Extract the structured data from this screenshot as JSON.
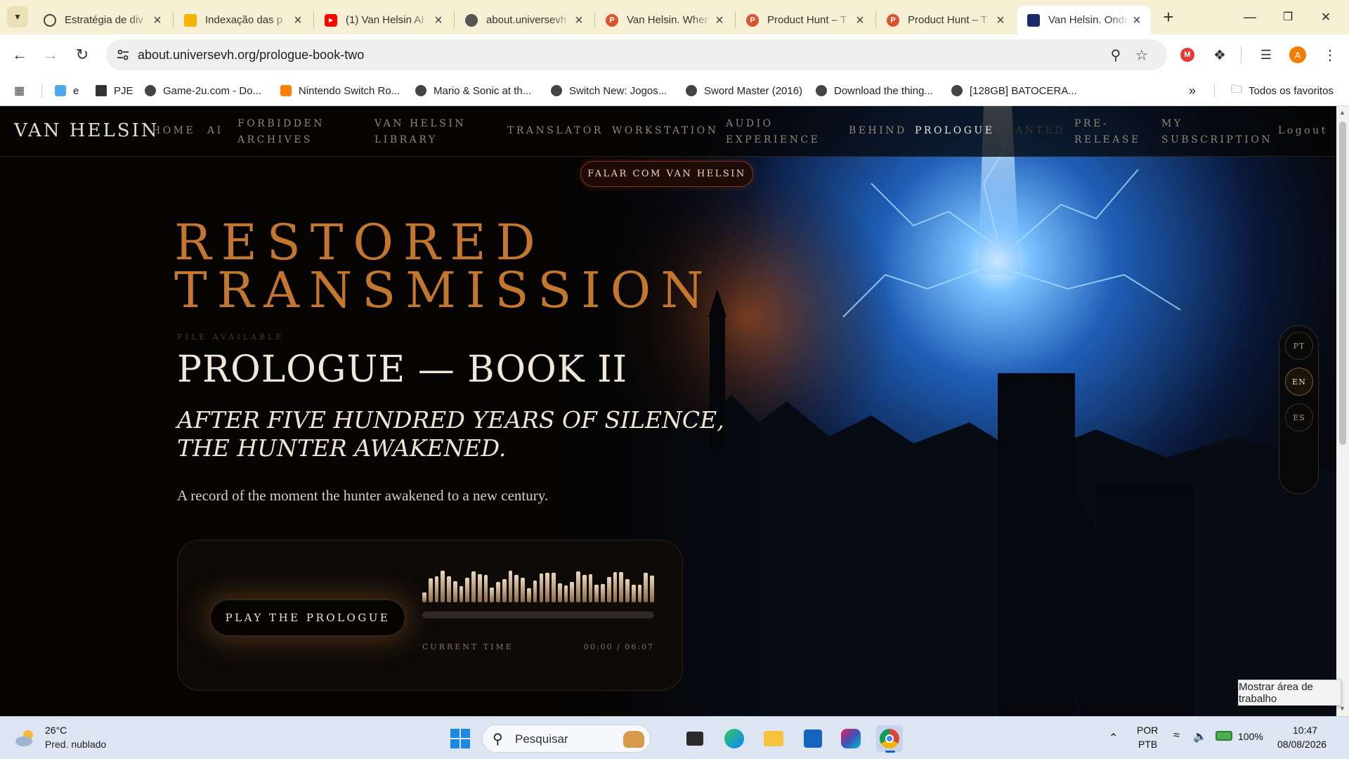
{
  "browser": {
    "tabs": [
      {
        "title": "Estratégia de div",
        "favicon_color": "#444444"
      },
      {
        "title": "Indexação das p",
        "favicon_color": "#f4b400"
      },
      {
        "title": "(1) Van Helsin AI",
        "favicon_color": "#ff0000"
      },
      {
        "title": "about.universevh",
        "favicon_color": "#555555"
      },
      {
        "title": "Van Helsin. Wher",
        "favicon_color": "#da552f"
      },
      {
        "title": "Product Hunt – T",
        "favicon_color": "#da552f"
      },
      {
        "title": "Product Hunt – T",
        "favicon_color": "#da552f"
      },
      {
        "title": "Van Helsin. Onde",
        "favicon_color": "#1a2a6c"
      }
    ],
    "url": "about.universevh.org/prologue-book-two",
    "profile_initial": "A",
    "extension_initial": "M",
    "bookmarks": [
      {
        "label": "e"
      },
      {
        "label": "PJE"
      },
      {
        "label": "Game-2u.com - Do..."
      },
      {
        "label": "Nintendo Switch Ro..."
      },
      {
        "label": "Mario & Sonic at th..."
      },
      {
        "label": "Switch New: Jogos..."
      },
      {
        "label": "Sword Master (2016)"
      },
      {
        "label": "Download the thing..."
      },
      {
        "label": "[128GB] BATOCERA..."
      }
    ],
    "all_bookmarks": "Todos os favoritos"
  },
  "site": {
    "logo": "VAN HELSIN",
    "nav": [
      {
        "label": "HOME"
      },
      {
        "label": "AI"
      },
      {
        "label": "FORBIDDEN ARCHIVES"
      },
      {
        "label": "VAN HELSIN LIBRARY"
      },
      {
        "label": "TRANSLATOR"
      },
      {
        "label": "WORKSTATION"
      },
      {
        "label": "AUDIO EXPERIENCE"
      },
      {
        "label": "BEHIND"
      },
      {
        "label": "PROLOGUE"
      },
      {
        "label": "WANTED"
      },
      {
        "label": "PRE-RELEASE"
      },
      {
        "label": "MY SUBSCRIPTION"
      },
      {
        "label": "Logout"
      }
    ],
    "cta": "FALAR COM VAN HELSIN"
  },
  "hero": {
    "title_line1": "RESTORED",
    "title_line2": "TRANSMISSION",
    "file_label": "FILE AVAILABLE",
    "heading": "PROLOGUE — BOOK II",
    "subtitle": "AFTER FIVE HUNDRED YEARS OF SILENCE, THE HUNTER AWAKENED.",
    "description": "A record of the moment the hunter awakened to a new century."
  },
  "player": {
    "play_label": "PLAY THE PROLOGUE",
    "time_label": "CURRENT TIME",
    "time_value": "00:00 / 06:07",
    "progress": 0
  },
  "languages": [
    {
      "code": "PT",
      "active": false
    },
    {
      "code": "EN",
      "active": true
    },
    {
      "code": "ES",
      "active": false
    }
  ],
  "tooltip": "Mostrar área de trabalho",
  "taskbar": {
    "temp": "26°C",
    "weather": "Pred. nublado",
    "search_placeholder": "Pesquisar",
    "lang_top": "POR",
    "lang_bottom": "PTB",
    "battery": "100%",
    "time": "10:47",
    "date": "08/08/2026"
  },
  "colors": {
    "accent_orange": "#c3762e",
    "page_bg": "#050403",
    "cta_border": "#7a3626"
  }
}
